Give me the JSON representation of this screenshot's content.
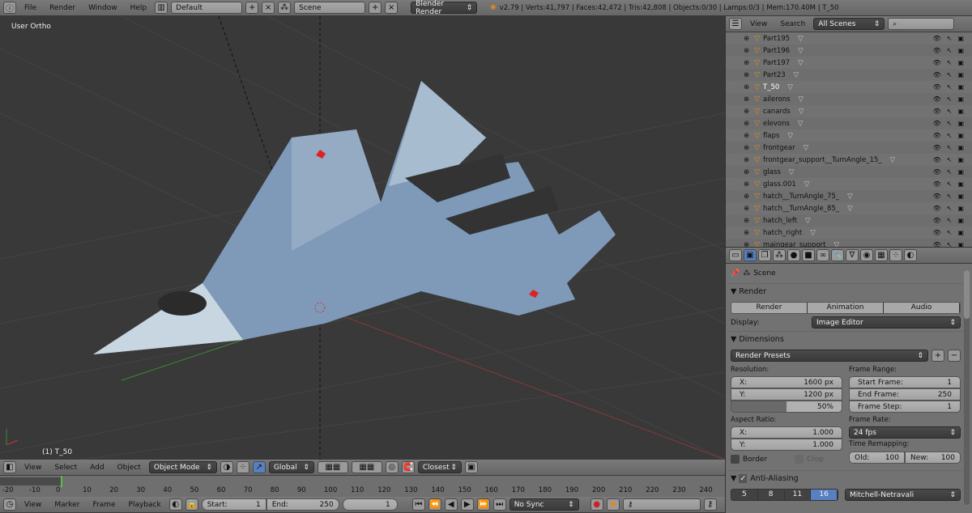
{
  "topbar": {
    "menus": [
      "File",
      "Render",
      "Window",
      "Help"
    ],
    "screen_layout": "Default",
    "scene": "Scene",
    "engine": "Blender Render",
    "stats": "v2.79 | Verts:41,797 | Faces:42,472 | Tris:42,808 | Objects:0/30 | Lamps:0/3 | Mem:170.40M | T_50"
  },
  "viewport": {
    "view_label": "User Ortho",
    "object_label": "(1) T_50"
  },
  "outliner": {
    "menus": [
      "View",
      "Search"
    ],
    "filter": "All Scenes",
    "items": [
      "Part195",
      "Part196",
      "Part197",
      "Part23",
      "T_50",
      "ailerons",
      "canards",
      "elevons",
      "flaps",
      "frontgear",
      "frontgear_support__TurnAngle_15_",
      "glass",
      "glass.001",
      "hatch__TurnAngle_75_",
      "hatch__TurnAngle_85_",
      "hatch_left",
      "hatch_right",
      "maingear_support"
    ]
  },
  "properties": {
    "context": "Scene",
    "render": {
      "title": "Render",
      "buttons": [
        "Render",
        "Animation",
        "Audio"
      ],
      "display_label": "Display:",
      "display_value": "Image Editor"
    },
    "dimensions": {
      "title": "Dimensions",
      "presets": "Render Presets",
      "resolution_label": "Resolution:",
      "res_x_label": "X:",
      "res_x": "1600 px",
      "res_y_label": "Y:",
      "res_y": "1200 px",
      "res_pct": "50%",
      "res_pct_value": 50,
      "aspect_label": "Aspect Ratio:",
      "asp_x_label": "X:",
      "asp_x": "1.000",
      "asp_y_label": "Y:",
      "asp_y": "1.000",
      "border": "Border",
      "crop": "Crop",
      "frame_range_label": "Frame Range:",
      "start_label": "Start Frame:",
      "start": "1",
      "end_label": "End Frame:",
      "end": "250",
      "step_label": "Frame Step:",
      "step": "1",
      "frame_rate_label": "Frame Rate:",
      "frame_rate": "24 fps",
      "remap_label": "Time Remapping:",
      "old_label": "Old:",
      "old": "100",
      "new_label": "New:",
      "new": "100"
    },
    "aa": {
      "title": "Anti-Aliasing",
      "samples": [
        "5",
        "8",
        "11",
        "16"
      ],
      "selected": "16",
      "filter": "Mitchell-Netravali"
    }
  },
  "view3d_header": {
    "menus": [
      "View",
      "Select",
      "Add",
      "Object"
    ],
    "mode": "Object Mode",
    "orientation": "Global",
    "snap": "Closest"
  },
  "timeline": {
    "ticks": [
      "-20",
      "-10",
      "0",
      "10",
      "20",
      "30",
      "40",
      "50",
      "60",
      "70",
      "80",
      "90",
      "100",
      "110",
      "120",
      "130",
      "140",
      "150",
      "160",
      "170",
      "180",
      "190",
      "200",
      "210",
      "220",
      "230",
      "240"
    ],
    "menus": [
      "View",
      "Marker",
      "Frame",
      "Playback"
    ],
    "start_label": "Start:",
    "start": "1",
    "end_label": "End:",
    "end": "250",
    "current": "1",
    "sync": "No Sync"
  },
  "colors": {
    "accent": "#5680c2",
    "selected_text": "#ffffff",
    "object_icon": "#e08a1e"
  }
}
